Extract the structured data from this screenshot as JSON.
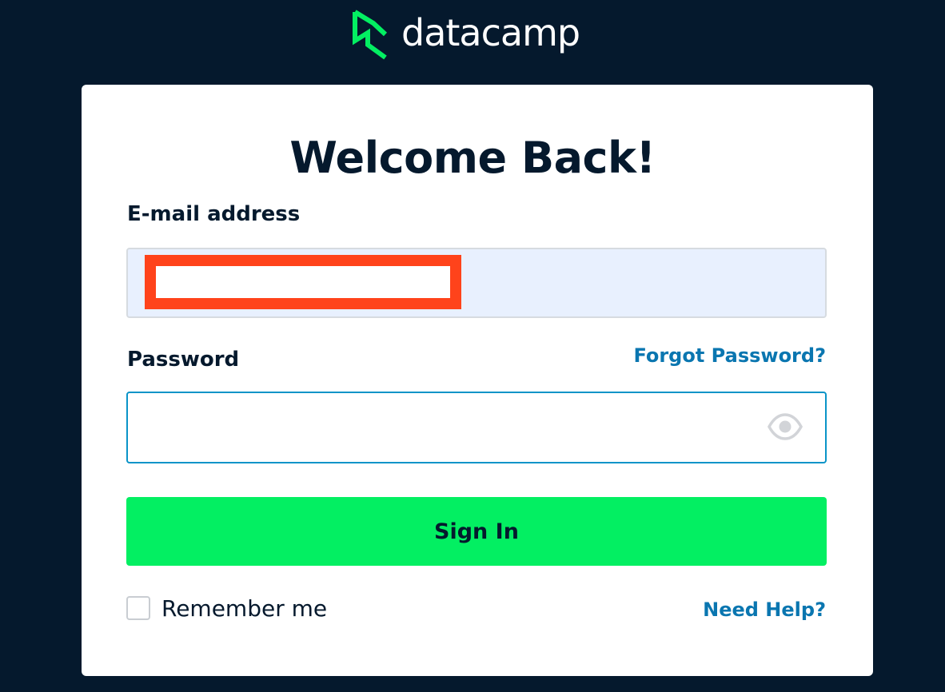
{
  "brand": {
    "name": "datacamp",
    "accent_color": "#03ef62",
    "background_color": "#05192d",
    "logo_icon": "datacamp-logo-icon"
  },
  "login": {
    "title": "Welcome Back!",
    "email_label": "E-mail address",
    "email_value": "",
    "password_label": "Password",
    "password_value": "",
    "forgot_password": "Forgot Password?",
    "sign_in_label": "Sign In",
    "remember_label": "Remember me",
    "remember_checked": false,
    "need_help": "Need Help?",
    "show_password_icon": "eye-icon"
  }
}
